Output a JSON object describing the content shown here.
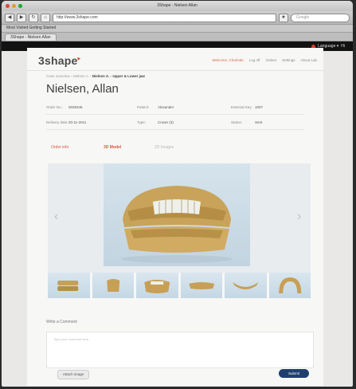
{
  "window": {
    "title": "3Shape - Nielsen Allan",
    "colors": {
      "close": "#e0443e",
      "minimize": "#dea123",
      "zoom": "#1aab29"
    }
  },
  "browser": {
    "back_icon": "back-arrow-icon",
    "forward_icon": "forward-arrow-icon",
    "url": "http://www.3shape.com",
    "search_placeholder": "Google",
    "bookmarks": "Most Visited  Getting Started",
    "tab_label": "3Shape - Nielsen Allan"
  },
  "appbar": {
    "language_label": "Language ▾",
    "flag_icon": "globe-icon",
    "extra": "Hi"
  },
  "header": {
    "logo_text": "3shape",
    "logo_mark": "▸",
    "nav": [
      "Welcome, Charlotte",
      "Log off",
      "Orders",
      "Settings",
      "About Lab"
    ]
  },
  "breadcrumb": {
    "path": "Case overview › Nielsen A. ›",
    "current": "Nielsen A. - Upper & Lower jaw"
  },
  "patient": {
    "name": "Nielsen, Allan",
    "fields": {
      "order_no_label": "Order No.:",
      "order_no_value": "0028345",
      "patient_label": "Patient:",
      "patient_value": "Alexander",
      "ext_id_label": "External Key:",
      "ext_id_value": "1007",
      "delivery_label": "Delivery date:",
      "delivery_value": "20-11-2011",
      "type_label": "Type:",
      "type_value": "Crown (3)",
      "status_label": "Status:",
      "status_value": "Sent"
    }
  },
  "tabs": [
    "Order info",
    "3D Model",
    "2D Images"
  ],
  "viewer": {
    "prev_icon": "chevron-left-icon",
    "next_icon": "chevron-right-icon",
    "thumbnails": [
      "Model 1",
      "Model 2",
      "Model 3",
      "Model 4",
      "Model 5",
      "Model 6"
    ]
  },
  "comment": {
    "label": "Write a Comment",
    "placeholder": "Type your comment here...",
    "attach_label": "Attach image",
    "submit_label": "Submit"
  }
}
